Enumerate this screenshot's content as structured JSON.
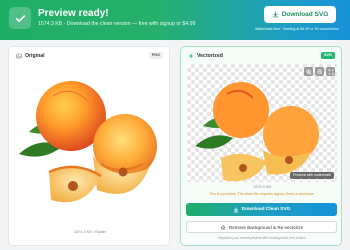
{
  "banner": {
    "title": "Preview ready!",
    "subtitle": "1574.3 KB · Download the clean version — free with signup or $4.99",
    "download_label": "Download SVG",
    "watermark_note": "Watermark-free · Starting at $4.99 or 50 conversions",
    "check_icon": "check-icon",
    "download_icon": "download-icon",
    "accent_from": "#1fae66",
    "accent_to": "#1692d8"
  },
  "original": {
    "heading": "Original",
    "badge": "PNG",
    "caption": "1574.3 KB • Raster",
    "icon": "image-icon"
  },
  "vectorized": {
    "heading": "Vectorized",
    "badge": "SVG",
    "watermark_tag": "Preview with watermark",
    "size": "1574.3 KB",
    "preview_note": "This is a preview. The clean file requires signup (free) or purchase.",
    "download_clean_label": "Download Clean SVG",
    "remove_bg_label": "Remove Background & Re-vectorize",
    "remove_hint": "Replaces your current preview with a background-free version",
    "zoom_icons": [
      "zoom-in-icon",
      "zoom-out-icon",
      "expand-icon"
    ],
    "badge_color": "#22b573",
    "note_color": "#d98a1a"
  }
}
